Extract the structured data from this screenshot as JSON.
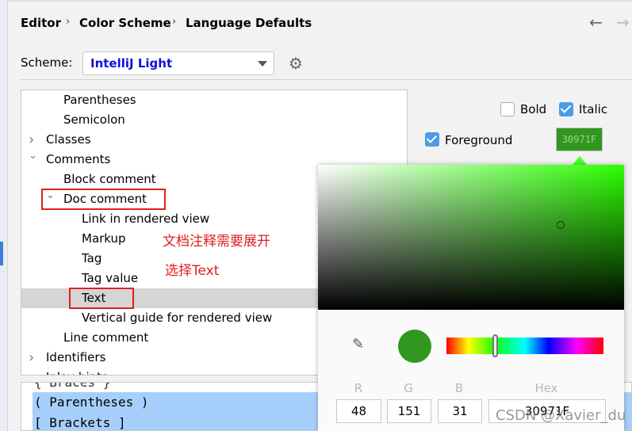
{
  "breadcrumb": [
    "Editor",
    "Color Scheme",
    "Language Defaults"
  ],
  "nav": {
    "back": "←",
    "forward": "→"
  },
  "scheme": {
    "label": "Scheme:",
    "value": "IntelliJ Light"
  },
  "tree": [
    {
      "label": "Parentheses",
      "level": 2
    },
    {
      "label": "Semicolon",
      "level": 2
    },
    {
      "label": "Classes",
      "level": 1,
      "expand": "collapsed"
    },
    {
      "label": "Comments",
      "level": 1,
      "expand": "expanded"
    },
    {
      "label": "Block comment",
      "level": 2
    },
    {
      "label": "Doc comment",
      "level": 2,
      "expand": "expanded"
    },
    {
      "label": "Link in rendered view",
      "level": 3
    },
    {
      "label": "Markup",
      "level": 3
    },
    {
      "label": "Tag",
      "level": 3
    },
    {
      "label": "Tag value",
      "level": 3
    },
    {
      "label": "Text",
      "level": 3,
      "selected": true
    },
    {
      "label": "Vertical guide for rendered view",
      "level": 3
    },
    {
      "label": "Line comment",
      "level": 2
    },
    {
      "label": "Identifiers",
      "level": 1,
      "expand": "collapsed"
    },
    {
      "label": "Inlay hints",
      "level": 1,
      "expand": "collapsed"
    }
  ],
  "annotations": [
    "文档注释需要展开",
    "选择Text"
  ],
  "preview": [
    "{ Braces }",
    "( Parentheses )",
    "[ Brackets ]"
  ],
  "options": {
    "bold_label": "Bold",
    "bold": false,
    "italic_label": "Italic",
    "italic": true,
    "foreground_label": "Foreground",
    "foreground": true,
    "foreground_hex": "30971F"
  },
  "picker": {
    "r_label": "R",
    "g_label": "G",
    "b_label": "B",
    "hex_label": "Hex",
    "r": "48",
    "g": "151",
    "b": "31",
    "hex": "30971F",
    "color": "#30971f"
  },
  "watermark": "CSDN @Xavier_du"
}
